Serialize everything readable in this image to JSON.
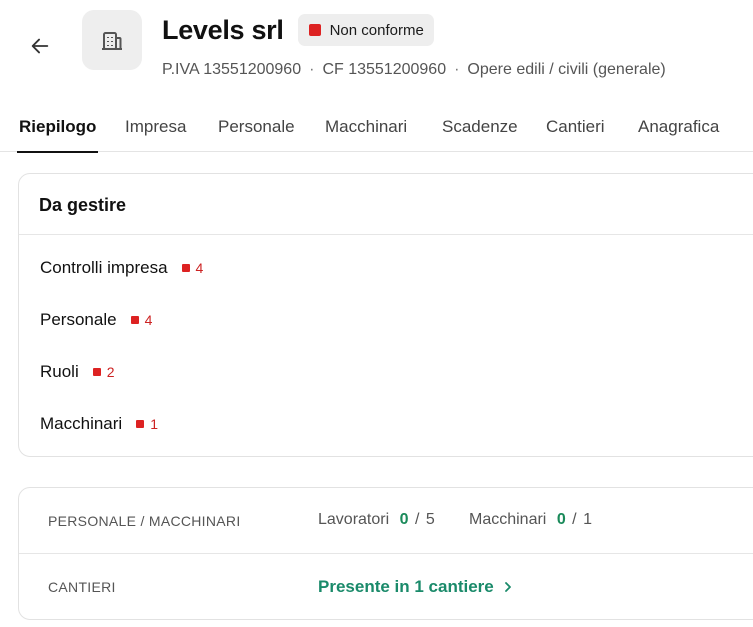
{
  "header": {
    "title": "Levels srl",
    "status_badge": "Non conforme",
    "status_color": "#dd2222",
    "piva": "P.IVA 13551200960",
    "cf": "CF 13551200960",
    "category": "Opere edili / civili (generale)",
    "separator": "·"
  },
  "tabs": [
    {
      "label": "Riepilogo",
      "active": true
    },
    {
      "label": "Impresa"
    },
    {
      "label": "Personale"
    },
    {
      "label": "Macchinari"
    },
    {
      "label": "Scadenze"
    },
    {
      "label": "Cantieri"
    },
    {
      "label": "Anagrafica"
    }
  ],
  "da_gestire": {
    "title": "Da gestire",
    "items": [
      {
        "label": "Controlli impresa",
        "count": "4"
      },
      {
        "label": "Personale",
        "count": "4"
      },
      {
        "label": "Ruoli",
        "count": "2"
      },
      {
        "label": "Macchinari",
        "count": "1"
      }
    ]
  },
  "summary": {
    "personale_label": "PERSONALE / MACCHINARI",
    "lavoratori_label": "Lavoratori",
    "lavoratori_value": "0",
    "lavoratori_total": "5",
    "macchinari_label": "Macchinari",
    "macchinari_value": "0",
    "macchinari_total": "1",
    "slash": "/",
    "cantieri_label": "CANTIERI",
    "cantieri_link": "Presente in 1 cantiere"
  },
  "icons": {
    "back": "arrow-left-icon",
    "company": "building-icon",
    "chevron": "chevron-right-icon"
  },
  "colors": {
    "accent_green": "#1a8a5a",
    "alert_red": "#dd2222"
  }
}
